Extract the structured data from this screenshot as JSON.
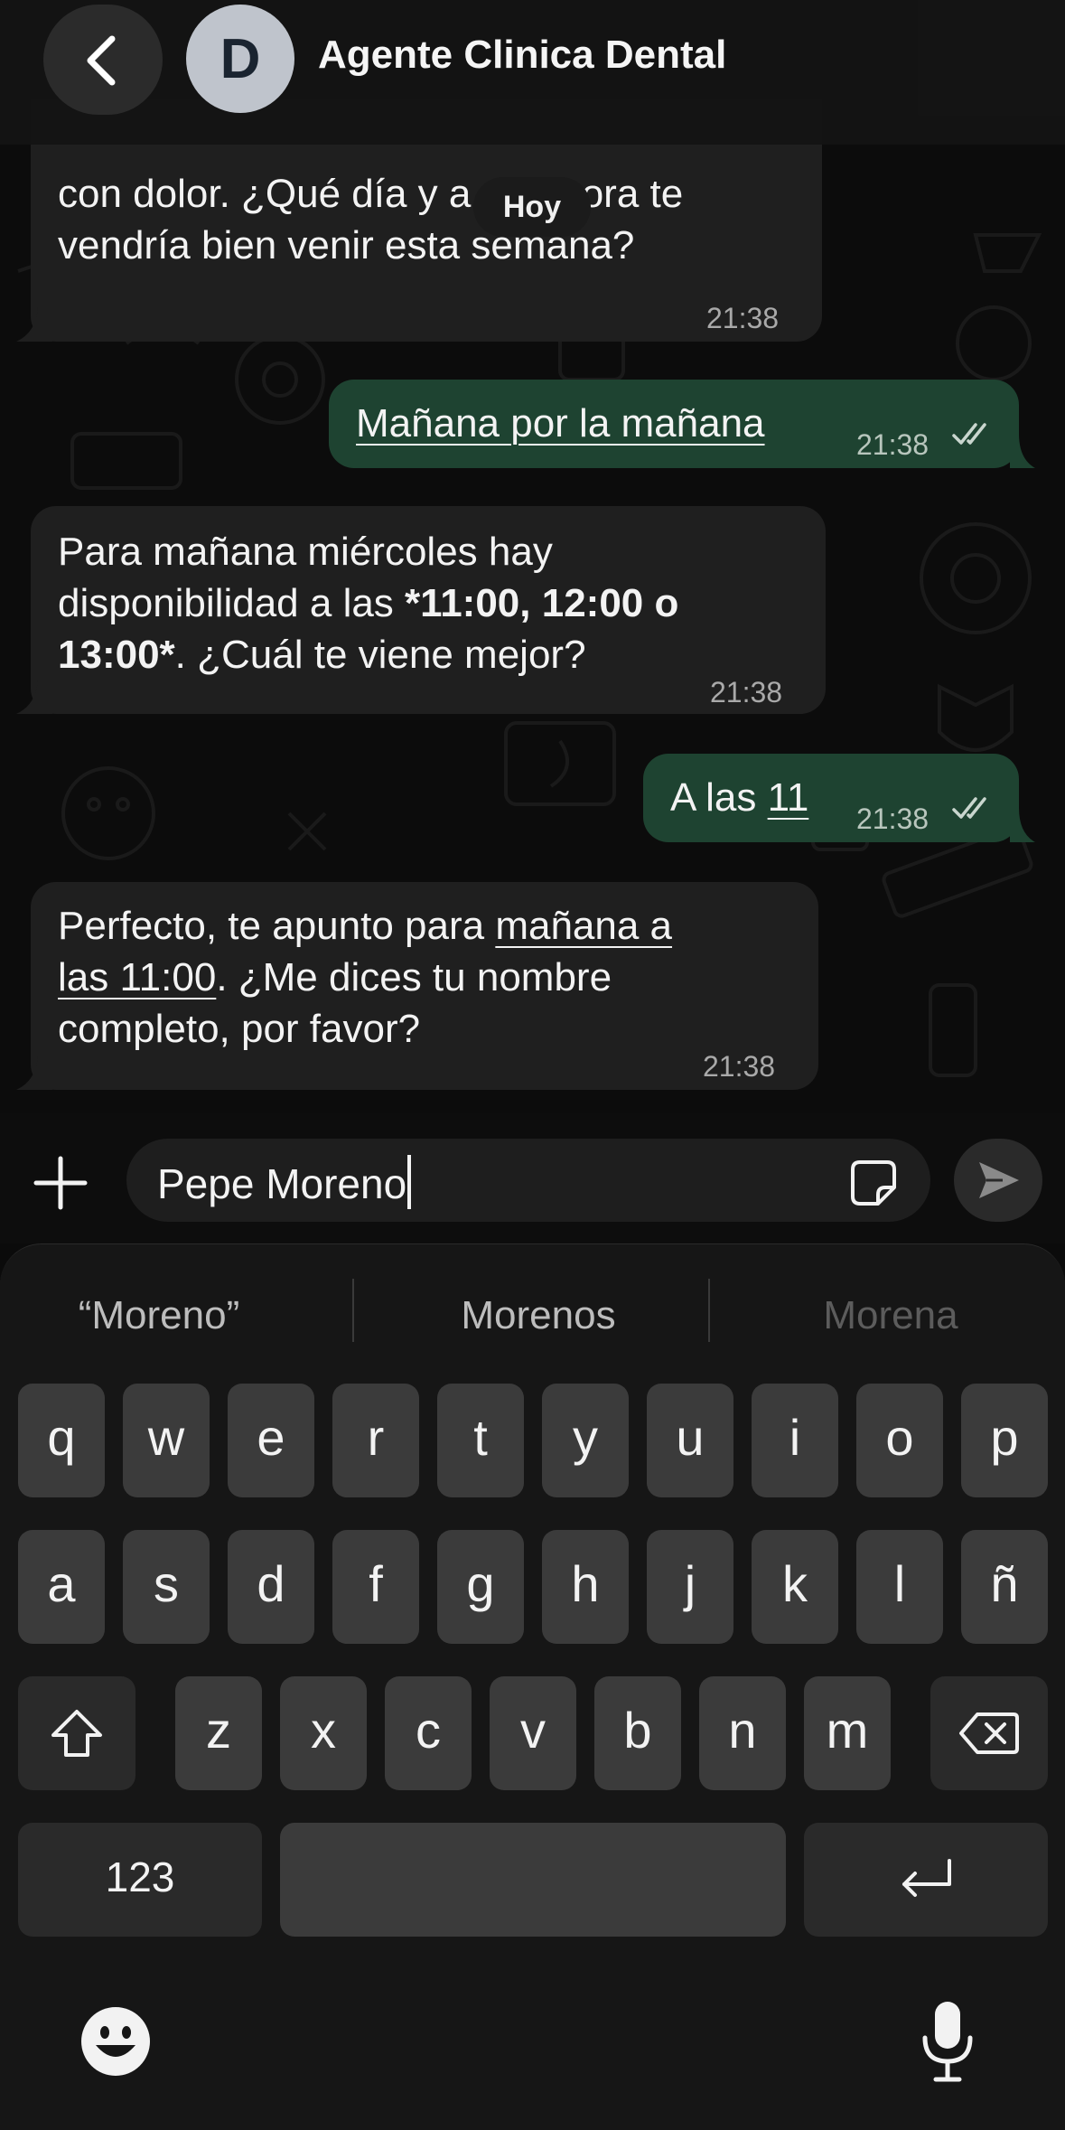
{
  "header": {
    "back_icon": "chevron-left-icon",
    "avatar_letter": "D",
    "title": "Agente Clinica Dental"
  },
  "date_chip": "Hoy",
  "messages": [
    {
      "direction": "in",
      "line1": "con dolor. ¿Qué día y a qué hora te",
      "line2": "vendría bien venir esta semana?",
      "time": "21:38"
    },
    {
      "direction": "out",
      "text": "Mañana por la mañana",
      "time": "21:38",
      "status": "read-ticks-icon"
    },
    {
      "direction": "in",
      "line1": "Para mañana miércoles hay",
      "line2_a": "disponibilidad a las ",
      "line2_b": "*11:00, 12:00 o",
      "line3_a": "13:00*",
      "line3_b": ". ¿Cuál te viene mejor?",
      "time": "21:38"
    },
    {
      "direction": "out",
      "text_a": "A las ",
      "text_b": "11",
      "time": "21:38",
      "status": "read-ticks-icon"
    },
    {
      "direction": "in",
      "line1_a": "Perfecto, te apunto para ",
      "line1_b": "mañana a",
      "line2_a": "las 11:00",
      "line2_b": ". ¿Me dices tu nombre",
      "line3": "completo, por favor?",
      "time": "21:38"
    }
  ],
  "composer": {
    "attach_icon": "plus-icon",
    "value": "Pepe Moreno",
    "sticker_icon": "sticker-icon",
    "send_icon": "send-icon"
  },
  "keyboard": {
    "suggestions": [
      "“Moreno”",
      "Morenos",
      "Morena"
    ],
    "row1": [
      "q",
      "w",
      "e",
      "r",
      "t",
      "y",
      "u",
      "i",
      "o",
      "p"
    ],
    "row2": [
      "a",
      "s",
      "d",
      "f",
      "g",
      "h",
      "j",
      "k",
      "l",
      "ñ"
    ],
    "row3": [
      "z",
      "x",
      "c",
      "v",
      "b",
      "n",
      "m"
    ],
    "numbers_label": "123",
    "shift_icon": "shift-icon",
    "delete_icon": "backspace-icon",
    "return_icon": "return-icon",
    "emoji_icon": "emoji-icon",
    "mic_icon": "microphone-icon"
  },
  "colors": {
    "incoming_bubble": "#1f1f1f",
    "outgoing_bubble": "#1e4331",
    "background": "#0c0c0c"
  }
}
